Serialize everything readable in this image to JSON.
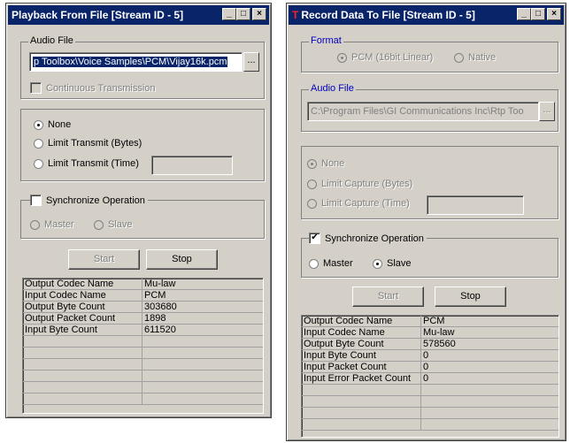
{
  "playback": {
    "title": "Playback From File [Stream ID - 5]",
    "audio_file_legend": "Audio File",
    "audio_file_value": "p Toolbox\\Voice Samples\\PCM\\Vijay16k.pcm",
    "browse_label": "...",
    "continuous_label": "Continuous Transmission",
    "none_label": "None",
    "limit_bytes_label": "Limit Transmit (Bytes)",
    "limit_time_label": "Limit Transmit (Time)",
    "sync_label": "Synchronize Operation",
    "master_label": "Master",
    "slave_label": "Slave",
    "start_label": "Start",
    "stop_label": "Stop",
    "stats": [
      {
        "name": "Output Codec Name",
        "value": "Mu-law"
      },
      {
        "name": "Input Codec Name",
        "value": "PCM"
      },
      {
        "name": "Output Byte Count",
        "value": "303680"
      },
      {
        "name": "Output Packet Count",
        "value": "1898"
      },
      {
        "name": "Input Byte Count",
        "value": "611520"
      }
    ]
  },
  "record": {
    "title": "Record Data To File [Stream ID - 5]",
    "format_legend": "Format",
    "pcm_label": "PCM (16bit Linear)",
    "native_label": "Native",
    "audio_file_legend": "Audio File",
    "audio_file_value": "C:\\Program Files\\GI Communications Inc\\Rtp Too",
    "browse_label": "...",
    "none_label": "None",
    "limit_bytes_label": "Limit Capture (Bytes)",
    "limit_time_label": "Limit Capture (Time)",
    "sync_label": "Synchronize Operation",
    "master_label": "Master",
    "slave_label": "Slave",
    "start_label": "Start",
    "stop_label": "Stop",
    "stats": [
      {
        "name": "Output Codec Name",
        "value": "PCM"
      },
      {
        "name": "Input Codec Name",
        "value": "Mu-law"
      },
      {
        "name": "Output Byte Count",
        "value": "578560"
      },
      {
        "name": "Input Byte Count",
        "value": "0"
      },
      {
        "name": "Input Packet Count",
        "value": "0"
      },
      {
        "name": "Input Error Packet Count",
        "value": "0"
      }
    ]
  },
  "title_buttons": {
    "minimize": "_",
    "maximize": "□",
    "close": "×"
  },
  "colors": {
    "titlebar": "#0a246a",
    "face": "#d4d0c8",
    "legend_blue": "#0000c0"
  }
}
